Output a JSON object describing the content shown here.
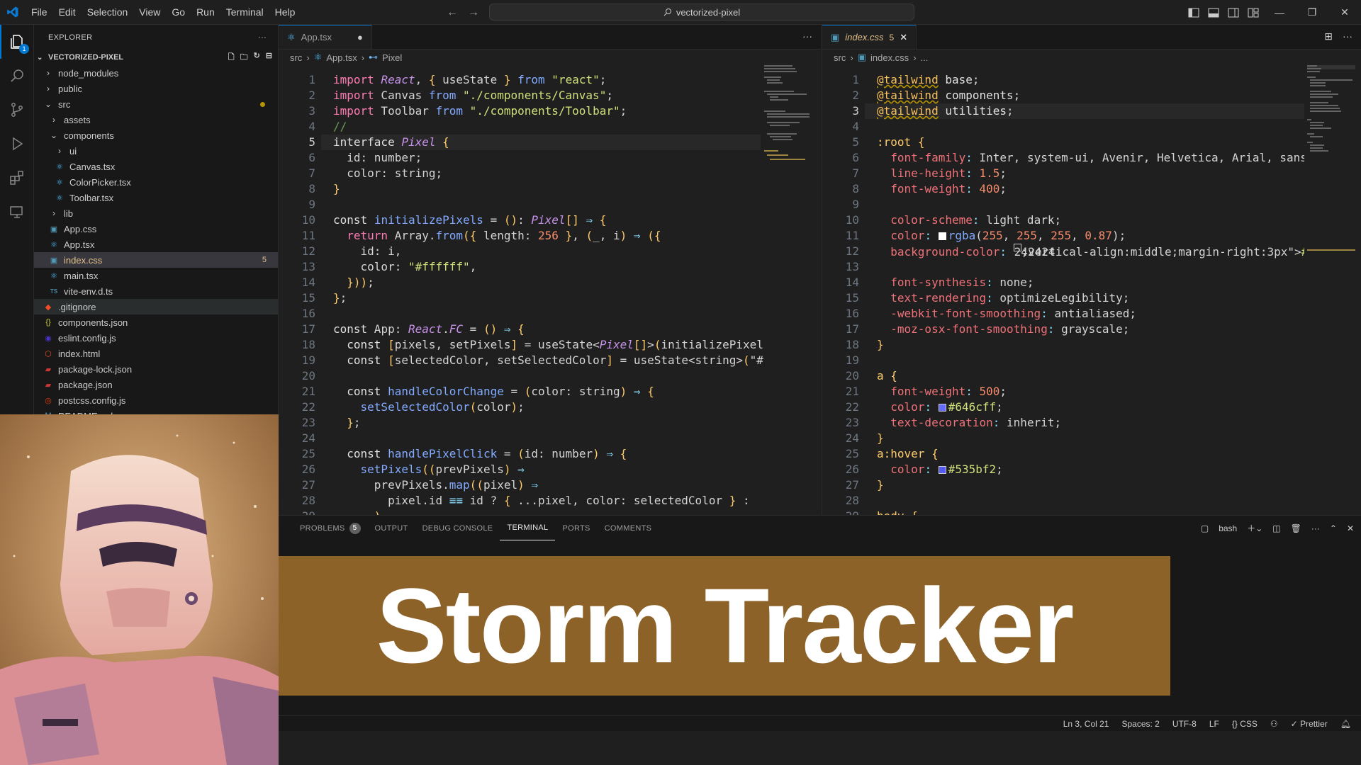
{
  "menu": [
    "File",
    "Edit",
    "Selection",
    "View",
    "Go",
    "Run",
    "Terminal",
    "Help"
  ],
  "command_center": "vectorized-pixel",
  "explorer": {
    "title": "EXPLORER",
    "project": "VECTORIZED-PIXEL",
    "items": [
      {
        "label": "node_modules",
        "indent": 0,
        "icon": "folder-icon",
        "color": "#cccccc"
      },
      {
        "label": "public",
        "indent": 0,
        "icon": "folder-icon",
        "color": "#cccccc"
      },
      {
        "label": "src",
        "indent": 0,
        "icon": "folder-open-icon",
        "color": "#cccccc",
        "dot": true
      },
      {
        "label": "assets",
        "indent": 1,
        "icon": "folder-icon",
        "color": "#cccccc"
      },
      {
        "label": "components",
        "indent": 1,
        "icon": "folder-open-icon",
        "color": "#cccccc"
      },
      {
        "label": "ui",
        "indent": 2,
        "icon": "folder-icon",
        "color": "#cccccc"
      },
      {
        "label": "Canvas.tsx",
        "indent": 2,
        "icon": "react-icon",
        "color": "#cccccc"
      },
      {
        "label": "ColorPicker.tsx",
        "indent": 2,
        "icon": "react-icon",
        "color": "#cccccc"
      },
      {
        "label": "Toolbar.tsx",
        "indent": 2,
        "icon": "react-icon",
        "color": "#cccccc"
      },
      {
        "label": "lib",
        "indent": 1,
        "icon": "folder-icon",
        "color": "#cccccc"
      },
      {
        "label": "App.css",
        "indent": 1,
        "icon": "css-icon",
        "color": "#cccccc"
      },
      {
        "label": "App.tsx",
        "indent": 1,
        "icon": "react-icon",
        "color": "#cccccc"
      },
      {
        "label": "index.css",
        "indent": 1,
        "icon": "css-icon",
        "color": "#e2c08d",
        "selected": true,
        "badge": "5"
      },
      {
        "label": "main.tsx",
        "indent": 1,
        "icon": "react-icon",
        "color": "#cccccc"
      },
      {
        "label": "vite-env.d.ts",
        "indent": 1,
        "icon": "ts-icon",
        "color": "#cccccc"
      },
      {
        "label": ".gitignore",
        "indent": 0,
        "icon": "git-icon",
        "color": "#cccccc",
        "hover": true
      },
      {
        "label": "components.json",
        "indent": 0,
        "icon": "json-icon",
        "color": "#cccccc"
      },
      {
        "label": "eslint.config.js",
        "indent": 0,
        "icon": "eslint-icon",
        "color": "#cccccc"
      },
      {
        "label": "index.html",
        "indent": 0,
        "icon": "html-icon",
        "color": "#cccccc"
      },
      {
        "label": "package-lock.json",
        "indent": 0,
        "icon": "npm-icon",
        "color": "#cccccc"
      },
      {
        "label": "package.json",
        "indent": 0,
        "icon": "npm-icon",
        "color": "#cccccc"
      },
      {
        "label": "postcss.config.js",
        "indent": 0,
        "icon": "postcss-icon",
        "color": "#cccccc"
      },
      {
        "label": "README.md",
        "indent": 0,
        "icon": "markdown-icon",
        "color": "#cccccc"
      }
    ],
    "activity_badge": "1"
  },
  "editor_left": {
    "tab": "App.tsx",
    "breadcrumb": [
      "src",
      "App.tsx",
      "Pixel"
    ],
    "current_line": 5,
    "lines": [
      "import React, { useState } from \"react\";",
      "import Canvas from \"./components/Canvas\";",
      "import Toolbar from \"./components/Toolbar\";",
      "//",
      "interface Pixel {",
      "  id: number;",
      "  color: string;",
      "}",
      "",
      "const initializePixels = (): Pixel[] ⇒ {",
      "  return Array.from({ length: 256 }, (_, i) ⇒ ({",
      "    id: i,",
      "    color: \"#ffffff\",",
      "  }));",
      "};",
      "",
      "const App: React.FC = () ⇒ {",
      "  const [pixels, setPixels] = useState<Pixel[]>(initializePixel",
      "  const [selectedColor, setSelectedColor] = useState<string>(\"#",
      "",
      "  const handleColorChange = (color: string) ⇒ {",
      "    setSelectedColor(color);",
      "  };",
      "",
      "  const handlePixelClick = (id: number) ⇒ {",
      "    setPixels((prevPixels) ⇒",
      "      prevPixels.map((pixel) ⇒",
      "        pixel.id ≡≡ id ? { ...pixel, color: selectedColor } :",
      "      )"
    ]
  },
  "editor_right": {
    "tab": "index.css",
    "tab_badge": "5",
    "breadcrumb": [
      "src",
      "index.css",
      "..."
    ],
    "current_line": 3,
    "lines": [
      "@tailwind base;",
      "@tailwind components;",
      "@tailwind utilities;",
      "",
      ":root {",
      "  font-family: Inter, system-ui, Avenir, Helvetica, Arial, sans",
      "  line-height: 1.5;",
      "  font-weight: 400;",
      "",
      "  color-scheme: light dark;",
      "  color: rgba(255, 255, 255, 0.87);",
      "  background-color: #242424;",
      "",
      "  font-synthesis: none;",
      "  text-rendering: optimizeLegibility;",
      "  -webkit-font-smoothing: antialiased;",
      "  -moz-osx-font-smoothing: grayscale;",
      "}",
      "",
      "a {",
      "  font-weight: 500;",
      "  color: #646cff;",
      "  text-decoration: inherit;",
      "}",
      "a:hover {",
      "  color: #535bf2;",
      "}",
      "",
      "body {"
    ]
  },
  "panel": {
    "tabs": [
      "PROBLEMS",
      "OUTPUT",
      "DEBUG CONSOLE",
      "TERMINAL",
      "PORTS",
      "COMMENTS"
    ],
    "active_tab": "TERMINAL",
    "problems_count": "5",
    "terminal_name": "bash"
  },
  "banner_text": "Storm Tracker",
  "status": {
    "position": "Ln 3, Col 21",
    "spaces": "Spaces: 2",
    "encoding": "UTF-8",
    "eol": "LF",
    "language": "CSS",
    "prettier": "Prettier"
  },
  "colors": {
    "accent": "#0078d4",
    "banner": "#8d6229",
    "modified": "#e2c08d"
  }
}
